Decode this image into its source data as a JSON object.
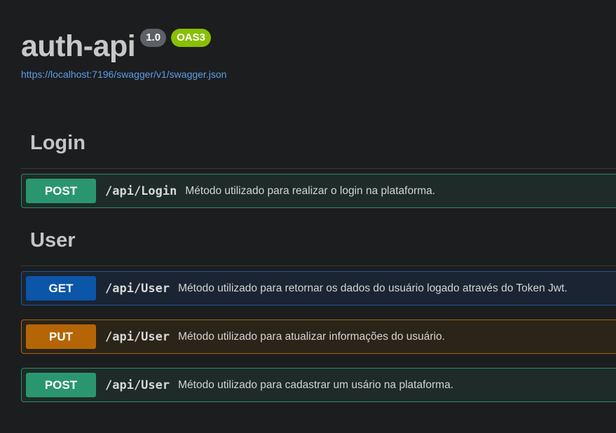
{
  "info": {
    "title": "auth-api",
    "version": "1.0",
    "oas_badge": "OAS3",
    "spec_url": "https://localhost:7196/swagger/v1/swagger.json"
  },
  "tags": [
    {
      "name": "Login",
      "operations": [
        {
          "method": "POST",
          "path": "/api/Login",
          "summary": "Método utilizado para realizar o login na plataforma."
        }
      ]
    },
    {
      "name": "User",
      "operations": [
        {
          "method": "GET",
          "path": "/api/User",
          "summary": "Método utilizado para retornar os dados do usuário logado através do Token Jwt."
        },
        {
          "method": "PUT",
          "path": "/api/User",
          "summary": "Método utilizado para atualizar informações do usuário."
        },
        {
          "method": "POST",
          "path": "/api/User",
          "summary": "Método utilizado para cadastrar um usário na plataforma."
        }
      ]
    }
  ],
  "colors": {
    "background": "#1c1d1f",
    "post": "#2a9670",
    "get": "#0b56a8",
    "put": "#b56505",
    "oas_badge": "#89bf04",
    "link": "#5c9ee8"
  }
}
